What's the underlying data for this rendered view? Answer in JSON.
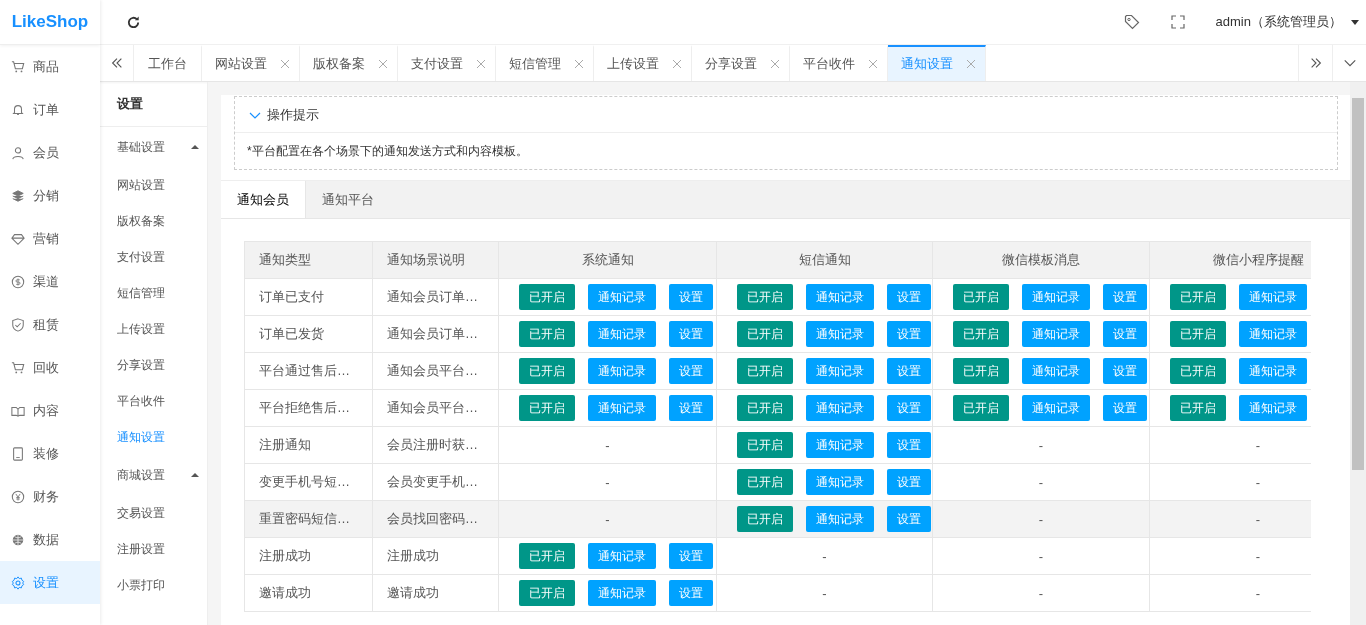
{
  "logo": "LikeShop",
  "header": {
    "user": "admin（系统管理员）"
  },
  "sidebar": {
    "items": [
      {
        "label": "商品",
        "selected": false
      },
      {
        "label": "订单",
        "selected": false
      },
      {
        "label": "会员",
        "selected": false
      },
      {
        "label": "分销",
        "selected": false
      },
      {
        "label": "营销",
        "selected": false
      },
      {
        "label": "渠道",
        "selected": false
      },
      {
        "label": "租赁",
        "selected": false
      },
      {
        "label": "回收",
        "selected": false
      },
      {
        "label": "内容",
        "selected": false
      },
      {
        "label": "装修",
        "selected": false
      },
      {
        "label": "财务",
        "selected": false
      },
      {
        "label": "数据",
        "selected": false
      },
      {
        "label": "设置",
        "selected": true
      }
    ]
  },
  "tabs": [
    {
      "label": "工作台",
      "closable": false,
      "selected": false
    },
    {
      "label": "网站设置",
      "closable": true,
      "selected": false
    },
    {
      "label": "版权备案",
      "closable": true,
      "selected": false
    },
    {
      "label": "支付设置",
      "closable": true,
      "selected": false
    },
    {
      "label": "短信管理",
      "closable": true,
      "selected": false
    },
    {
      "label": "上传设置",
      "closable": true,
      "selected": false
    },
    {
      "label": "分享设置",
      "closable": true,
      "selected": false
    },
    {
      "label": "平台收件",
      "closable": true,
      "selected": false
    },
    {
      "label": "通知设置",
      "closable": true,
      "selected": true
    }
  ],
  "submenu": {
    "title": "设置",
    "groups": [
      {
        "label": "基础设置",
        "expanded": true,
        "items": [
          {
            "label": "网站设置",
            "selected": false
          },
          {
            "label": "版权备案",
            "selected": false
          },
          {
            "label": "支付设置",
            "selected": false
          },
          {
            "label": "短信管理",
            "selected": false
          },
          {
            "label": "上传设置",
            "selected": false
          },
          {
            "label": "分享设置",
            "selected": false
          },
          {
            "label": "平台收件",
            "selected": false
          },
          {
            "label": "通知设置",
            "selected": true
          }
        ]
      },
      {
        "label": "商城设置",
        "expanded": true,
        "items": [
          {
            "label": "交易设置",
            "selected": false
          },
          {
            "label": "注册设置",
            "selected": false
          },
          {
            "label": "小票打印",
            "selected": false
          }
        ]
      }
    ]
  },
  "tips": {
    "title": "操作提示",
    "expanded": true,
    "text": "*平台配置在各个场景下的通知发送方式和内容模板。"
  },
  "subtabs": [
    {
      "label": "通知会员",
      "selected": true
    },
    {
      "label": "通知平台",
      "selected": false
    }
  ],
  "table": {
    "columns": [
      "通知类型",
      "通知场景说明",
      "系统通知",
      "短信通知",
      "微信模板消息",
      "微信小程序提醒"
    ],
    "rows": [
      {
        "type": "订单已支付",
        "scene": "通知会员订单…",
        "hovered": false,
        "channels": [
          {
            "buttons": [
              {
                "label": "已开启",
                "kind": "status"
              },
              {
                "label": "通知记录",
                "kind": "action"
              },
              {
                "label": "设置",
                "kind": "action"
              }
            ]
          },
          {
            "buttons": [
              {
                "label": "已开启",
                "kind": "status"
              },
              {
                "label": "通知记录",
                "kind": "action"
              },
              {
                "label": "设置",
                "kind": "action"
              }
            ]
          },
          {
            "buttons": [
              {
                "label": "已开启",
                "kind": "status"
              },
              {
                "label": "通知记录",
                "kind": "action"
              },
              {
                "label": "设置",
                "kind": "action"
              }
            ]
          },
          {
            "buttons": [
              {
                "label": "已开启",
                "kind": "status"
              },
              {
                "label": "通知记录",
                "kind": "action"
              }
            ]
          }
        ]
      },
      {
        "type": "订单已发货",
        "scene": "通知会员订单…",
        "hovered": false,
        "channels": [
          {
            "buttons": [
              {
                "label": "已开启",
                "kind": "status"
              },
              {
                "label": "通知记录",
                "kind": "action"
              },
              {
                "label": "设置",
                "kind": "action"
              }
            ]
          },
          {
            "buttons": [
              {
                "label": "已开启",
                "kind": "status"
              },
              {
                "label": "通知记录",
                "kind": "action"
              },
              {
                "label": "设置",
                "kind": "action"
              }
            ]
          },
          {
            "buttons": [
              {
                "label": "已开启",
                "kind": "status"
              },
              {
                "label": "通知记录",
                "kind": "action"
              },
              {
                "label": "设置",
                "kind": "action"
              }
            ]
          },
          {
            "buttons": [
              {
                "label": "已开启",
                "kind": "status"
              },
              {
                "label": "通知记录",
                "kind": "action"
              }
            ]
          }
        ]
      },
      {
        "type": "平台通过售后…",
        "scene": "通知会员平台…",
        "hovered": false,
        "channels": [
          {
            "buttons": [
              {
                "label": "已开启",
                "kind": "status"
              },
              {
                "label": "通知记录",
                "kind": "action"
              },
              {
                "label": "设置",
                "kind": "action"
              }
            ]
          },
          {
            "buttons": [
              {
                "label": "已开启",
                "kind": "status"
              },
              {
                "label": "通知记录",
                "kind": "action"
              },
              {
                "label": "设置",
                "kind": "action"
              }
            ]
          },
          {
            "buttons": [
              {
                "label": "已开启",
                "kind": "status"
              },
              {
                "label": "通知记录",
                "kind": "action"
              },
              {
                "label": "设置",
                "kind": "action"
              }
            ]
          },
          {
            "buttons": [
              {
                "label": "已开启",
                "kind": "status"
              },
              {
                "label": "通知记录",
                "kind": "action"
              }
            ]
          }
        ]
      },
      {
        "type": "平台拒绝售后…",
        "scene": "通知会员平台…",
        "hovered": false,
        "channels": [
          {
            "buttons": [
              {
                "label": "已开启",
                "kind": "status"
              },
              {
                "label": "通知记录",
                "kind": "action"
              },
              {
                "label": "设置",
                "kind": "action"
              }
            ]
          },
          {
            "buttons": [
              {
                "label": "已开启",
                "kind": "status"
              },
              {
                "label": "通知记录",
                "kind": "action"
              },
              {
                "label": "设置",
                "kind": "action"
              }
            ]
          },
          {
            "buttons": [
              {
                "label": "已开启",
                "kind": "status"
              },
              {
                "label": "通知记录",
                "kind": "action"
              },
              {
                "label": "设置",
                "kind": "action"
              }
            ]
          },
          {
            "buttons": [
              {
                "label": "已开启",
                "kind": "status"
              },
              {
                "label": "通知记录",
                "kind": "action"
              }
            ]
          }
        ]
      },
      {
        "type": "注册通知",
        "scene": "会员注册时获…",
        "hovered": false,
        "channels": [
          {
            "text": "-"
          },
          {
            "buttons": [
              {
                "label": "已开启",
                "kind": "status"
              },
              {
                "label": "通知记录",
                "kind": "action"
              },
              {
                "label": "设置",
                "kind": "action"
              }
            ]
          },
          {
            "text": "-"
          },
          {
            "text": "-"
          }
        ]
      },
      {
        "type": "变更手机号短…",
        "scene": "会员变更手机…",
        "hovered": false,
        "channels": [
          {
            "text": "-"
          },
          {
            "buttons": [
              {
                "label": "已开启",
                "kind": "status"
              },
              {
                "label": "通知记录",
                "kind": "action"
              },
              {
                "label": "设置",
                "kind": "action"
              }
            ]
          },
          {
            "text": "-"
          },
          {
            "text": "-"
          }
        ]
      },
      {
        "type": "重置密码短信…",
        "scene": "会员找回密码…",
        "hovered": true,
        "channels": [
          {
            "text": "-"
          },
          {
            "buttons": [
              {
                "label": "已开启",
                "kind": "status"
              },
              {
                "label": "通知记录",
                "kind": "action"
              },
              {
                "label": "设置",
                "kind": "action"
              }
            ]
          },
          {
            "text": "-"
          },
          {
            "text": "-"
          }
        ]
      },
      {
        "type": "注册成功",
        "scene": "注册成功",
        "hovered": false,
        "channels": [
          {
            "buttons": [
              {
                "label": "已开启",
                "kind": "status"
              },
              {
                "label": "通知记录",
                "kind": "action"
              },
              {
                "label": "设置",
                "kind": "action"
              }
            ]
          },
          {
            "text": "-"
          },
          {
            "text": "-"
          },
          {
            "text": "-"
          }
        ]
      },
      {
        "type": "邀请成功",
        "scene": "邀请成功",
        "hovered": false,
        "channels": [
          {
            "buttons": [
              {
                "label": "已开启",
                "kind": "status"
              },
              {
                "label": "通知记录",
                "kind": "action"
              },
              {
                "label": "设置",
                "kind": "action"
              }
            ]
          },
          {
            "text": "-"
          },
          {
            "text": "-"
          },
          {
            "text": "-"
          }
        ]
      }
    ]
  }
}
